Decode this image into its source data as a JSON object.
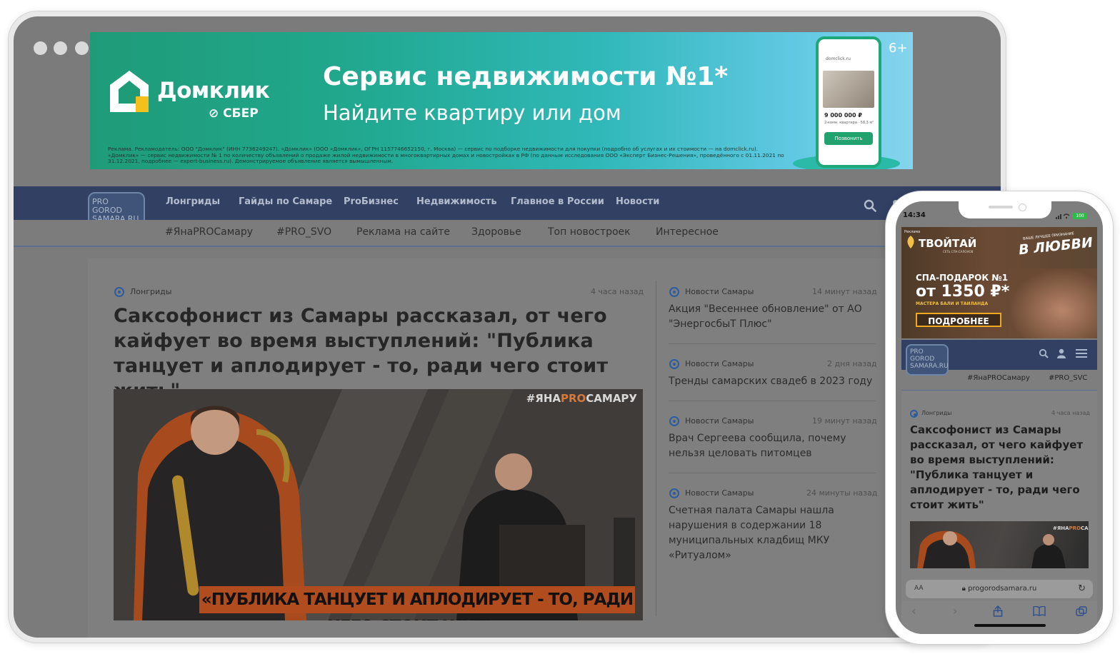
{
  "banner": {
    "brand": "Домклик",
    "brand_sub": "СБЕР",
    "title": "Сервис недвижимости №1*",
    "subtitle": "Найдите квартиру или дом",
    "age": "6+",
    "legal": "Реклама. Рекламодатель: ООО \"Домклик\" (ИНН 7736249247). «Домклик» (ООО «Домклик», ОГРН 1157746652150, г. Москва) — сервис по подборке недвижимости для покупки (подробно об услугах и их стоимости — на domclick.ru). «Домклик» — сервис недвижимости № 1 по количеству объявлений о продаже жилой недвижимости в многоквартирных домах и новостройках в РФ (по данным исследования ООО «Эксперт Бизнес-Решения», проведённого с 01.11.2021 по 31.12.2021, подробнее — expert-business.ru). Демонстрируемое объявление является вымышленным.",
    "phone": {
      "url": "domclick.ru",
      "price": "9 000 000 ₽",
      "desc": "2-комн. квартира · 58,3 м²",
      "button": "Позвонить"
    }
  },
  "site": {
    "logo_lines": [
      "PRO",
      "GOROD",
      "SAMARA.RU"
    ],
    "logo_sub": "НОВОСТИ САМАРЫ"
  },
  "nav_primary": [
    "Лонгриды",
    "Гайды по Самаре",
    "ProБизнес",
    "Недвижимость",
    "Главное в России",
    "Новости"
  ],
  "nav_secondary": [
    "#ЯнаPROСамару",
    "#PRO_SVO",
    "Реклама на сайте",
    "Здоровье",
    "Топ новостроек",
    "Интересное"
  ],
  "main_article": {
    "category": "Лонгриды",
    "time": "4 часа назад",
    "title": "Саксофонист из Самары рассказал, от чего кайфует во время выступлений: \"Публика танцует и аплодирует - то, ради чего стоит жить\"",
    "image_hashtag_pre": "#ЯНА",
    "image_hashtag_pro": "PRO",
    "image_hashtag_post": "САМАРУ",
    "image_caption": "«ПУБЛИКА ТАНЦУЕТ И АПЛОДИРУЕТ - ТО, РАДИ ЧЕГО СТОИТ ЖИТЬ»"
  },
  "side_news": [
    {
      "category": "Новости Самары",
      "time": "14 минут назад",
      "title": "Акция \"Весеннее обновление\" от АО \"ЭнергосбыТ Плюс\""
    },
    {
      "category": "Новости Самары",
      "time": "2 дня назад",
      "title": "Тренды самарских свадеб в 2023 году"
    },
    {
      "category": "Новости Самары",
      "time": "19 минут назад",
      "title": "Врач Сергеева сообщила, почему нельзя целовать питомцев"
    },
    {
      "category": "Новости Самары",
      "time": "24 минуты назад",
      "title": "Счетная палата Самары нашла нарушения в содержании 18 муниципальных кладбищ МКУ «Ритуалом»"
    }
  ],
  "phone": {
    "status_time": "14:34",
    "battery": "100",
    "ad": {
      "label": "Реклама",
      "brand": "ТВОЙТАЙ",
      "brand_sub": "СЕТЬ СПА-САЛОНОВ",
      "love_sub": "ВАШЕ ЛУЧШЕЕ ПРИЗНАНИЕ",
      "love": "В ЛЮБВИ",
      "spa": "СПА-ПОДАРОК №1",
      "price": "от 1350 ₽*",
      "masters": "МАСТЕРА БАЛИ И ТАИЛАНДА",
      "button": "ПОДРОБНЕЕ"
    },
    "tags": [
      "#ЯнаPROСамару",
      "#PRO_SVC"
    ],
    "article": {
      "category": "Лонгриды",
      "time": "4 часа назад",
      "title": "Саксофонист из Самары рассказал, от чего кайфует во время выступлений: \"Публика танцует и аплодирует - то, ради чего стоит жить\""
    },
    "url_aa": "AA",
    "url": "progorodsamara.ru"
  },
  "colors": {
    "nav": "#324063",
    "overlay": "#7b7b7b",
    "banner_green": "#1f9b78",
    "accent_blue": "#2d5c9e"
  }
}
